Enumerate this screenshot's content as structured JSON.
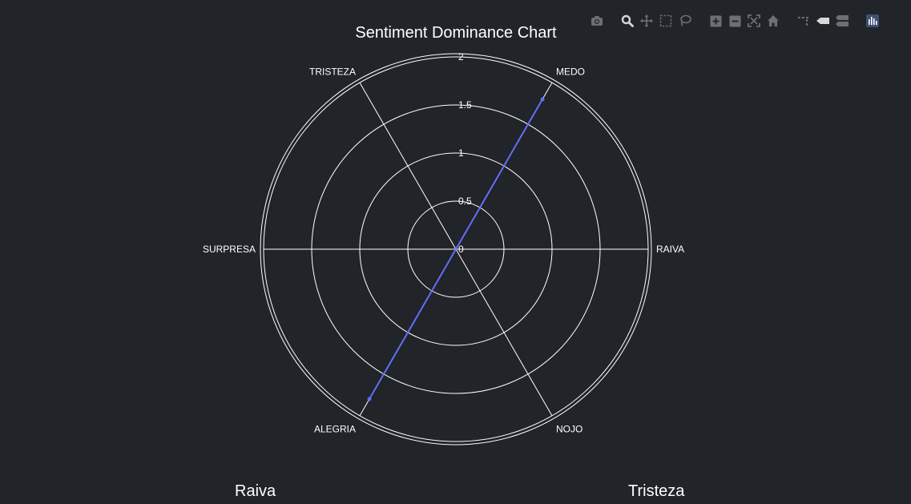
{
  "chart_data": {
    "type": "polar-line",
    "title": "Sentiment Dominance Chart",
    "theta_categories": [
      "RAIVA",
      "MEDO",
      "TRISTEZA",
      "SURPRESA",
      "ALEGRIA",
      "NOJO"
    ],
    "theta_angles_deg": [
      0,
      60,
      120,
      180,
      240,
      300
    ],
    "radial_range": [
      0,
      2
    ],
    "radial_ticks": [
      0,
      0.5,
      1,
      1.5,
      2
    ],
    "radial_tick_labels": [
      "0",
      "0.5",
      "1",
      "1.5",
      "2"
    ],
    "series": [
      {
        "categories": [
          "MEDO",
          "ALEGRIA"
        ],
        "values": [
          1.8,
          1.8
        ],
        "color": "#636efa",
        "mode": "lines"
      }
    ],
    "grid": true,
    "background_color": "#212428",
    "grid_color": "#ffffff"
  },
  "bottom_labels": {
    "left": "Raiva",
    "right": "Tristeza"
  },
  "modebar": {
    "icons": [
      "camera-icon",
      "zoom-icon",
      "pan-icon",
      "box-select-icon",
      "lasso-select-icon",
      "zoom-in-icon",
      "zoom-out-icon",
      "autoscale-icon",
      "reset-axes-icon",
      "spike-lines-icon",
      "hover-closest-icon",
      "hover-compare-icon",
      "plotly-logo-icon"
    ],
    "icon_color": "#6d6f73",
    "active_color": "#d8d8d8"
  }
}
